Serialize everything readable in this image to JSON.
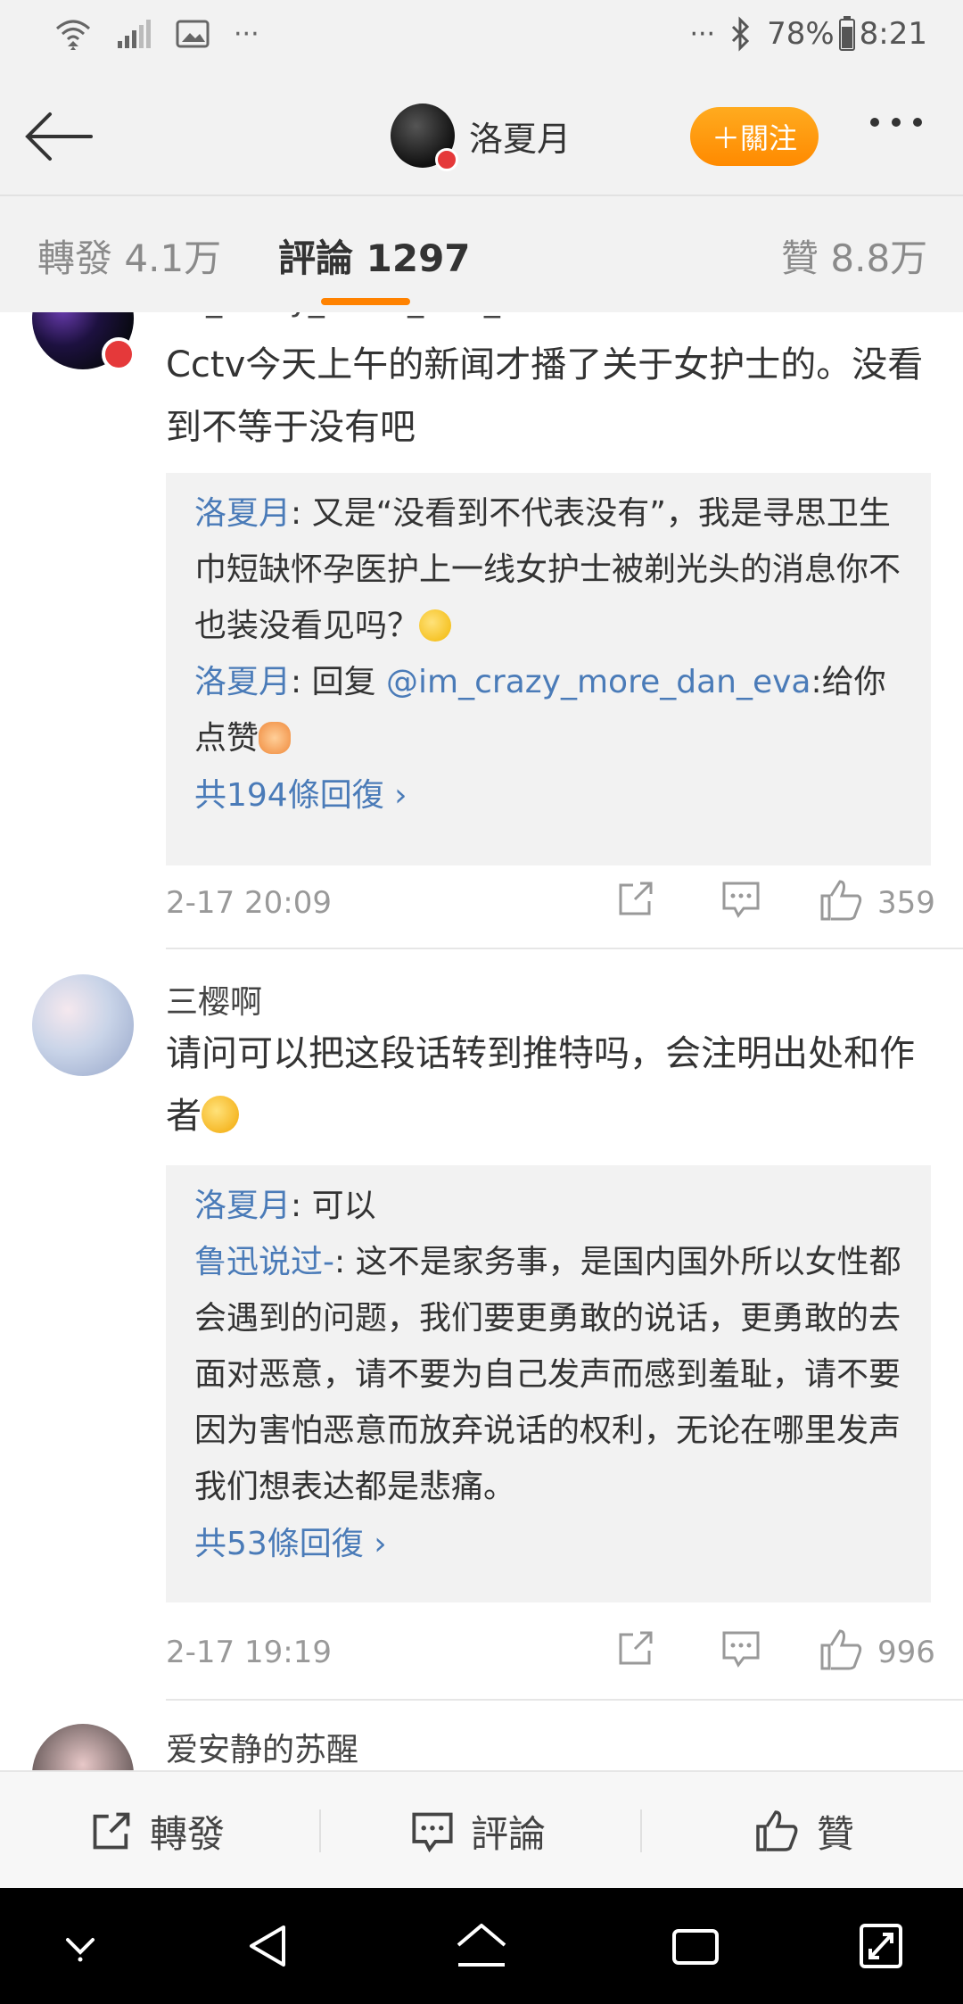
{
  "status_bar": {
    "battery": "78%",
    "time": "8:21",
    "left_more": "···",
    "right_more": "···"
  },
  "header": {
    "username": "洛夏月",
    "follow_label": "＋關注"
  },
  "tabs": [
    {
      "label": "轉發",
      "count": "4.1万"
    },
    {
      "label": "評論",
      "count": "1297"
    },
    {
      "label": "贊",
      "count": "8.8万"
    }
  ],
  "comments": [
    {
      "username": "im_crazy_more_dan_eva",
      "text": "Cctv今天上午的新闻才播了关于女护士的。没看到不等于没有吧",
      "replies": [
        {
          "user": "洛夏月",
          "sep": ": ",
          "text": "又是“没看到不代表没有”，我是寻思卫生巾短缺怀孕医护上一线女护士被剃光头的消息你不也装没看见吗？"
        },
        {
          "user": "洛夏月",
          "sep": ": ",
          "prefix": "回复 ",
          "mention": "@im_crazy_more_dan_eva",
          "text": ":给你点赞"
        }
      ],
      "more_replies": "共194條回復",
      "time": "2-17 20:09",
      "likes": "359"
    },
    {
      "username": "三樱啊",
      "text": "请问可以把这段话转到推特吗，会注明出处和作者",
      "replies": [
        {
          "user": "洛夏月",
          "sep": ": ",
          "text": "可以"
        },
        {
          "user": "鲁迅说过-",
          "sep": ": ",
          "text": "这不是家务事，是国内国外所以女性都会遇到的问题，我们要更勇敢的说话，更勇敢的去面对恶意，请不要为自己发声而感到羞耻，请不要因为害怕恶意而放弃说话的权利，无论在哪里发声我们想表达都是悲痛。"
        }
      ],
      "more_replies": "共53條回復",
      "time": "2-17 19:19",
      "likes": "996"
    },
    {
      "username": "爱安静的苏醒"
    }
  ],
  "bottom_bar": {
    "repost": "轉發",
    "comment": "評論",
    "like": "贊"
  }
}
